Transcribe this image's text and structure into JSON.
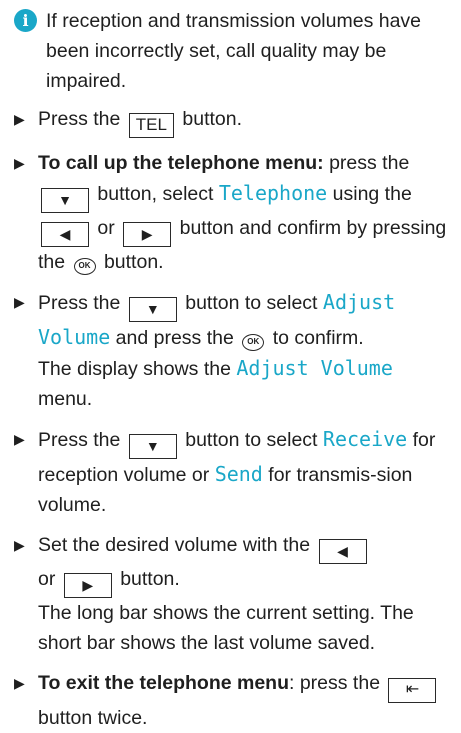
{
  "note": {
    "icon": "info-icon",
    "text": "If reception and transmission volumes have been incorrectly set, call quality may be impaired."
  },
  "keys": {
    "tel": "TEL",
    "down": "▼",
    "left": "◀",
    "right": "▶",
    "ok": "OK",
    "back": "⇤"
  },
  "steps": {
    "s1": {
      "a": "Press the",
      "b": "button."
    },
    "s2": {
      "bold": "To call up the telephone menu:",
      "a": "press the",
      "b": "button, select",
      "disp": "Telephone",
      "c": "using the",
      "d": "or",
      "e": "button and confirm by pressing the",
      "f": "button."
    },
    "s3": {
      "a": "Press the",
      "b": "button to select",
      "disp1": "Adjust Volume",
      "c": "and press the",
      "d": "to confirm.",
      "e": "The display shows the",
      "disp2": "Adjust Volume",
      "f": "menu."
    },
    "s4": {
      "a": "Press the",
      "b": "button to select",
      "disp1": "Receive",
      "c": "for reception volume or",
      "disp2": "Send",
      "d": "for transmis-sion volume."
    },
    "s5": {
      "a": "Set the desired volume with the",
      "b": "or",
      "c": "button.",
      "d": "The long bar shows the current setting. The short bar shows the last volume saved."
    },
    "s6": {
      "bold": "To exit the telephone menu",
      "a": ": press the",
      "b": "button twice."
    }
  },
  "colors": {
    "accent": "#1aa7c8",
    "text": "#1f1f1f"
  }
}
